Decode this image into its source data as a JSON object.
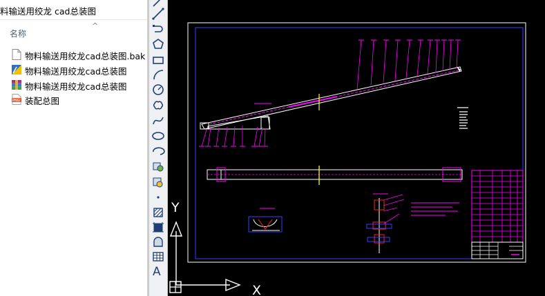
{
  "explorer": {
    "title": "料输送用绞龙 cad总装图",
    "column_header": "名称",
    "files": [
      {
        "name": "物料输送用绞龙cad总装图.bak",
        "icon": "blank-file-icon"
      },
      {
        "name": "物料输送用绞龙cad总装图",
        "icon": "dwg-file-icon"
      },
      {
        "name": "物料输送用绞龙cad总装图",
        "icon": "rar-archive-icon"
      },
      {
        "name": "装配总图",
        "icon": "png-image-icon"
      }
    ]
  },
  "toolbar": {
    "tools": [
      "line-tool-icon",
      "construction-line-icon",
      "polyline-icon",
      "polygon-icon",
      "rectangle-icon",
      "arc-icon",
      "circle-icon",
      "revision-cloud-icon",
      "spline-icon",
      "ellipse-icon",
      "ellipse-arc-icon",
      "insert-block-icon",
      "make-block-icon",
      "point-icon",
      "hatch-icon",
      "gradient-icon",
      "region-icon",
      "table-icon"
    ],
    "text_tool": "A"
  },
  "cad": {
    "ucs_x": "X",
    "ucs_y": "Y",
    "colors": {
      "frame": "#ffffff",
      "inner_frame": "#3c3cff",
      "annotation": "#ff00ff",
      "centerline": "#ffff00",
      "part_red": "#ff2020"
    }
  }
}
